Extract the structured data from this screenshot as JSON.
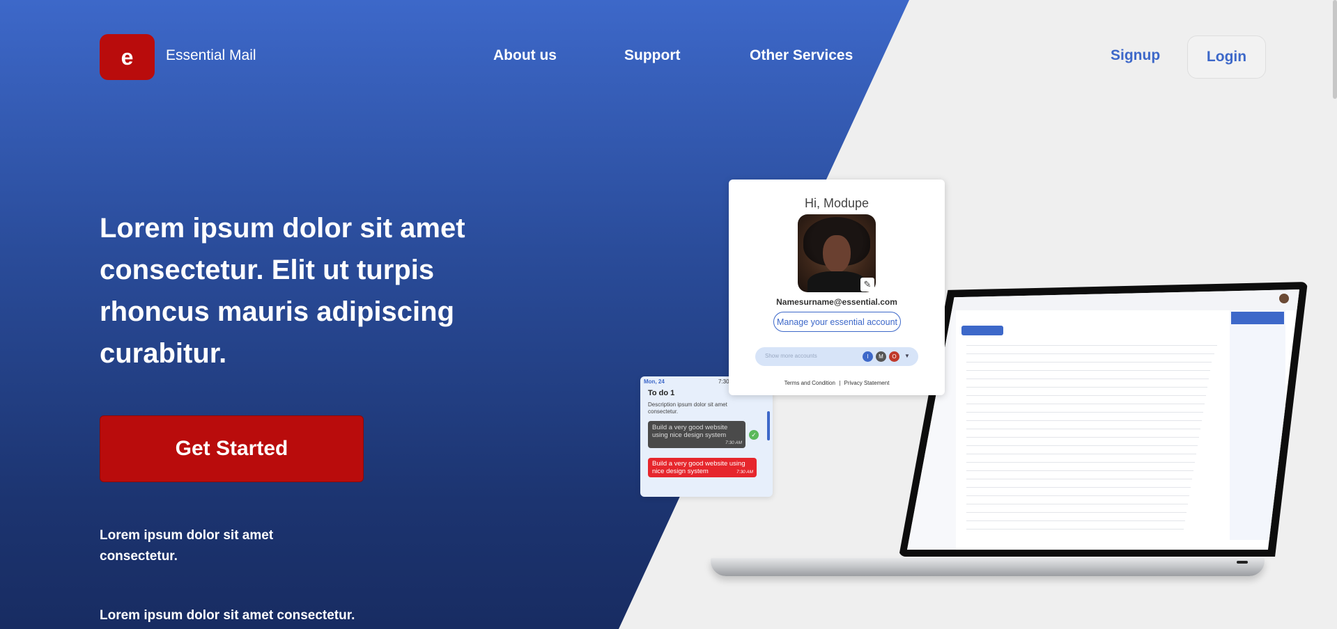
{
  "brand": {
    "logo_letter": "e",
    "name": "Essential Mail"
  },
  "nav": {
    "about": "About us",
    "support": "Support",
    "services": "Other Services"
  },
  "auth": {
    "signup": "Signup",
    "login": "Login"
  },
  "hero": {
    "headline": "Lorem ipsum dolor sit amet consectetur. Elit ut turpis rhoncus mauris adipiscing curabitur.",
    "cta": "Get Started",
    "subtext_1": "Lorem ipsum dolor sit amet consectetur.",
    "subtext_2": "Lorem ipsum dolor sit amet consectetur."
  },
  "account_card": {
    "greeting": "Hi, Modupe",
    "email": "Namesurname@essential.com",
    "manage_label": "Manage your essential account",
    "accounts_placeholder": "Show more accounts",
    "account_initials": [
      "I",
      "M",
      "O"
    ],
    "terms": "Terms and Condition",
    "privacy": "Privacy Statement"
  },
  "todo_card": {
    "date": "Mon, 24",
    "time": "7:30",
    "title": "To do 1",
    "description": "Description ipsum dolor sit amet consectetur.",
    "item_1": "Build a very good website using nice design system",
    "item_1_time": "7:30 AM",
    "item_2": "Build a very good website using nice design system",
    "item_2_time": "7:30 AM"
  },
  "colors": {
    "brand_blue": "#3d68c9",
    "brand_red": "#b90c0c",
    "hero_dark": "#182c62",
    "page_bg": "#efefef"
  }
}
